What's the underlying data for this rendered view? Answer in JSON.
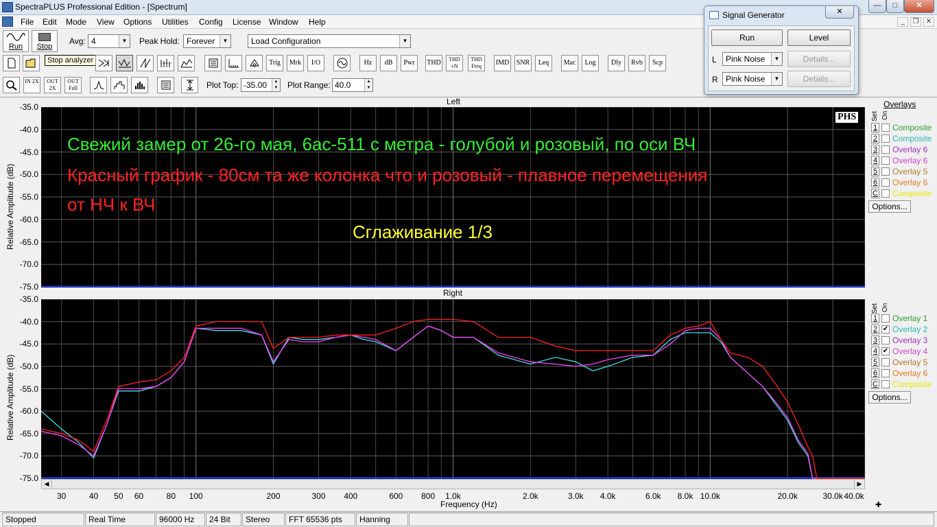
{
  "window": {
    "title": "SpectraPLUS Professional Edition - [Spectrum]"
  },
  "menu": [
    "File",
    "Edit",
    "Mode",
    "View",
    "Options",
    "Utilities",
    "Config",
    "License",
    "Window",
    "Help"
  ],
  "toolbar": {
    "run_label": "Run",
    "stop_label": "Stop",
    "tooltip": "Stop analyzer",
    "avg_label": "Avg:",
    "avg_value": "4",
    "peak_hold_label": "Peak Hold:",
    "peak_hold_value": "Forever",
    "config_value": "Load Configuration",
    "text_buttons": [
      "Trig",
      "Mrk",
      "I/O",
      "Hz",
      "dB",
      "Pwr",
      "THD",
      "IMD",
      "SNR",
      "Leq",
      "Mac",
      "Log",
      "Dly",
      "Rvb",
      "Scp"
    ],
    "thd_n_label": "THD +N",
    "thd_freq_label": "THD Freq",
    "in_label": "IN 2X",
    "out2x_label": "OUT 2X",
    "outfull_label": "OUT Full",
    "plot_top_label": "Plot Top:",
    "plot_top_value": "-35.00",
    "plot_range_label": "Plot Range:",
    "plot_range_value": "40.0"
  },
  "plot_left": {
    "title": "Left",
    "ylabel": "Relative Amplitude (dB)",
    "yticks": [
      "-35.0",
      "-40.0",
      "-45.0",
      "-50.0",
      "-55.0",
      "-60.0",
      "-65.0",
      "-70.0",
      "-75.0"
    ],
    "watermark": "PHS",
    "annotation_line1": "Свежий замер от 26-го мая, 6ас-511 с метра - голубой и розовый, по оси ВЧ",
    "annotation_line2": "Красный график - 80см та же колонка что и розовый - плавное перемещения",
    "annotation_line3": "от НЧ к ВЧ",
    "annotation_line4": "Сглаживание 1/3",
    "annotation_green": "#33ee33",
    "annotation_red": "#ff2222",
    "annotation_yellow": "#ffff33"
  },
  "plot_right": {
    "title": "Right",
    "ylabel": "Relative Amplitude (dB)",
    "yticks": [
      "-35.0",
      "-40.0",
      "-45.0",
      "-50.0",
      "-55.0",
      "-60.0",
      "-65.0",
      "-70.0",
      "-75.0"
    ],
    "xlabel": "Frequency (Hz)",
    "xticks": [
      "30",
      "40",
      "50",
      "60",
      "80",
      "100",
      "200",
      "300",
      "400",
      "600",
      "800",
      "1.0k",
      "2.0k",
      "3.0k",
      "4.0k",
      "6.0k",
      "8.0k",
      "10.0k",
      "20.0k",
      "30.0k",
      "40.0k"
    ]
  },
  "overlays_left": {
    "header": "Overlays",
    "set_label": "Set",
    "on_label": "On",
    "rows": [
      {
        "num": "1",
        "name": "Composite",
        "checked": false,
        "color": "#2f9a2f"
      },
      {
        "num": "2",
        "name": "Composite",
        "checked": false,
        "color": "#2ab5b5"
      },
      {
        "num": "3",
        "name": "Overlay 6",
        "checked": false,
        "color": "#a030c0"
      },
      {
        "num": "4",
        "name": "Overlay 6",
        "checked": false,
        "color": "#d040d0"
      },
      {
        "num": "5",
        "name": "Overlay 5",
        "checked": false,
        "color": "#b07a30"
      },
      {
        "num": "6",
        "name": "Overlay 6",
        "checked": false,
        "color": "#e07a20"
      },
      {
        "num": "C",
        "name": "Composite",
        "checked": false,
        "color": "#e8e800"
      }
    ],
    "options_label": "Options..."
  },
  "overlays_right": {
    "set_label": "Set",
    "on_label": "On",
    "rows": [
      {
        "num": "1",
        "name": "Overlay 1",
        "checked": false,
        "color": "#2f9a2f"
      },
      {
        "num": "2",
        "name": "Overlay 2",
        "checked": true,
        "color": "#2ab5b5"
      },
      {
        "num": "3",
        "name": "Overlay 3",
        "checked": false,
        "color": "#a030c0"
      },
      {
        "num": "4",
        "name": "Overlay 4",
        "checked": true,
        "color": "#d040d0"
      },
      {
        "num": "5",
        "name": "Overlay 5",
        "checked": false,
        "color": "#b07a30"
      },
      {
        "num": "6",
        "name": "Overlay 6",
        "checked": false,
        "color": "#e07a20"
      },
      {
        "num": "C",
        "name": "Composite",
        "checked": false,
        "color": "#e8e800"
      }
    ],
    "options_label": "Options..."
  },
  "status": [
    "Stopped",
    "Real Time",
    "96000 Hz",
    "24 Bit",
    "Stereo",
    "FFT 65536 pts",
    "Hanning"
  ],
  "signal_generator": {
    "title": "Signal Generator",
    "run_label": "Run",
    "level_label": "Level",
    "l_label": "L",
    "r_label": "R",
    "l_value": "Pink Noise",
    "r_value": "Pink Noise",
    "details_label": "Details..."
  },
  "chart_data": {
    "type": "line",
    "xscale": "log",
    "xlim": [
      25,
      40000
    ],
    "ylim": [
      -75,
      -35
    ],
    "series": [
      {
        "name": "Overlay 2",
        "color": "#40e0e0",
        "x": [
          25,
          30,
          35,
          40,
          45,
          50,
          60,
          70,
          80,
          90,
          100,
          120,
          150,
          180,
          200,
          230,
          260,
          300,
          350,
          400,
          450,
          500,
          600,
          700,
          800,
          900,
          1000,
          1200,
          1500,
          2000,
          2500,
          3000,
          3500,
          4000,
          5000,
          6000,
          7000,
          8000,
          9000,
          10000,
          11000,
          12000,
          14000,
          16000,
          18000,
          20000,
          22000,
          24000,
          25000,
          26000,
          30000,
          40000
        ],
        "y": [
          -60,
          -64,
          -67,
          -70.5,
          -63,
          -55.5,
          -55.5,
          -54.5,
          -52.5,
          -49,
          -41.5,
          -42,
          -42,
          -43,
          -49.5,
          -43.5,
          -44,
          -44,
          -43.5,
          -43,
          -44,
          -44.5,
          -46.5,
          -43.5,
          -41,
          -42,
          -43.5,
          -43.5,
          -47.5,
          -49.5,
          -48,
          -49,
          -51,
          -50,
          -48,
          -47.5,
          -44,
          -42.5,
          -42.5,
          -42.5,
          -44.5,
          -48,
          -51.5,
          -54.5,
          -58.5,
          -62,
          -67,
          -70,
          -75,
          -75,
          -75,
          -75
        ]
      },
      {
        "name": "Overlay 4",
        "color": "#ff40ff",
        "x": [
          25,
          30,
          35,
          40,
          45,
          50,
          60,
          70,
          80,
          90,
          100,
          120,
          150,
          180,
          200,
          230,
          260,
          300,
          350,
          400,
          450,
          500,
          600,
          700,
          800,
          900,
          1000,
          1200,
          1500,
          2000,
          2500,
          3000,
          3500,
          4000,
          5000,
          6000,
          7000,
          8000,
          9000,
          10000,
          11000,
          12000,
          14000,
          16000,
          18000,
          20000,
          22000,
          24000,
          25000,
          26000,
          30000,
          40000
        ],
        "y": [
          -64.5,
          -65.5,
          -67.5,
          -70,
          -63,
          -55,
          -55,
          -54.5,
          -52.5,
          -49,
          -41.5,
          -41.5,
          -41.5,
          -43,
          -49,
          -44,
          -44.5,
          -44.5,
          -43.5,
          -43,
          -43.5,
          -44,
          -46.5,
          -43.5,
          -41,
          -42,
          -43.5,
          -43.5,
          -47,
          -49,
          -49.5,
          -50,
          -49.5,
          -48.5,
          -47.5,
          -47.5,
          -45,
          -42,
          -41.5,
          -41.5,
          -44,
          -48,
          -51.5,
          -54.5,
          -58,
          -61.5,
          -66.5,
          -69.5,
          -75,
          -75,
          -75,
          -75
        ]
      },
      {
        "name": "",
        "color": "#ff2020",
        "x": [
          25,
          30,
          35,
          40,
          45,
          50,
          60,
          70,
          80,
          90,
          100,
          120,
          150,
          180,
          200,
          230,
          260,
          300,
          350,
          400,
          450,
          500,
          600,
          700,
          800,
          900,
          1000,
          1200,
          1500,
          2000,
          2500,
          3000,
          3500,
          4000,
          5000,
          6000,
          7000,
          8000,
          9000,
          10000,
          11000,
          12000,
          14000,
          16000,
          18000,
          20000,
          22000,
          24000,
          25000,
          26000,
          30000,
          40000
        ],
        "y": [
          -64,
          -65,
          -66.5,
          -69,
          -62,
          -54.5,
          -53.5,
          -53,
          -51,
          -48,
          -41,
          -40,
          -40,
          -40,
          -46,
          -43.5,
          -43.5,
          -43.5,
          -43,
          -43,
          -43,
          -43,
          -41.5,
          -40,
          -39.5,
          -39.5,
          -39.5,
          -40,
          -43.5,
          -43.5,
          -45.5,
          -46.5,
          -46.5,
          -46.5,
          -46.5,
          -46.5,
          -43,
          -41.5,
          -41,
          -40,
          -44,
          -47,
          -48,
          -50,
          -54,
          -58,
          -63,
          -68,
          -70,
          -75,
          -75,
          -75
        ]
      }
    ]
  }
}
